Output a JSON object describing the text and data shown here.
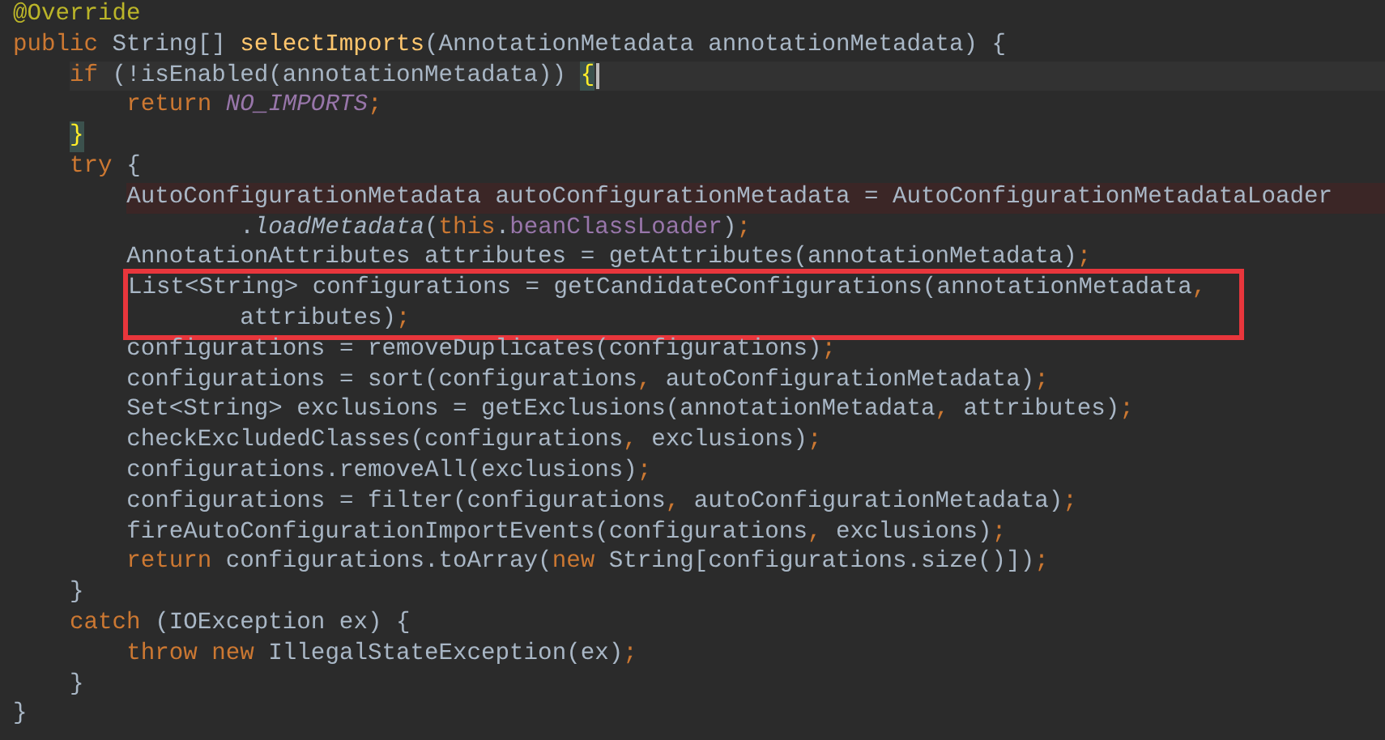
{
  "editor": {
    "lines": [
      {
        "kind": "line",
        "current": false,
        "marked": false,
        "boxed": false,
        "tokens": [
          {
            "text": "@Override",
            "kind": "annotation"
          }
        ]
      },
      {
        "kind": "line",
        "current": false,
        "marked": false,
        "boxed": false,
        "tokens": [
          {
            "text": "public",
            "kind": "keyword"
          },
          {
            "text": " String[] ",
            "kind": "plain"
          },
          {
            "text": "selectImports",
            "kind": "decl"
          },
          {
            "text": "(AnnotationMetadata annotationMetadata) {",
            "kind": "plain"
          }
        ],
        "children": [
          {
            "kind": "line",
            "current": true,
            "marked": false,
            "boxed": false,
            "tokens": [
              {
                "text": "if",
                "kind": "keyword"
              },
              {
                "text": " (!isEnabled(annotationMetadata)) ",
                "kind": "plain"
              },
              {
                "text": "{",
                "kind": "match"
              }
            ],
            "children": [
              {
                "kind": "line",
                "current": false,
                "marked": false,
                "boxed": false,
                "tokens": [
                  {
                    "text": "return ",
                    "kind": "keyword"
                  },
                  {
                    "text": "NO_IMPORTS",
                    "kind": "constant"
                  },
                  {
                    "text": ";",
                    "kind": "punct"
                  }
                ]
              }
            ]
          },
          {
            "kind": "line",
            "current": false,
            "marked": false,
            "boxed": false,
            "tokens": [
              {
                "text": "}",
                "kind": "match"
              }
            ]
          },
          {
            "kind": "line",
            "current": false,
            "marked": false,
            "boxed": false,
            "tokens": [
              {
                "text": "try",
                "kind": "keyword"
              },
              {
                "text": " {",
                "kind": "plain"
              }
            ],
            "children": [
              {
                "kind": "line",
                "current": false,
                "marked": true,
                "boxed": false,
                "tokens": [
                  {
                    "text": "AutoConfigurationMetadata autoConfigurationMetadata = AutoConfigurationMetadataLoader",
                    "kind": "plain"
                  }
                ],
                "children": [
                  {
                    "kind": "continuation",
                    "current": false,
                    "marked": false,
                    "boxed": false,
                    "tokens": [
                      {
                        "text": ".",
                        "kind": "plain"
                      },
                      {
                        "text": "loadMetadata",
                        "kind": "static"
                      },
                      {
                        "text": "(",
                        "kind": "plain"
                      },
                      {
                        "text": "this",
                        "kind": "keyword"
                      },
                      {
                        "text": ".",
                        "kind": "plain"
                      },
                      {
                        "text": "beanClassLoader",
                        "kind": "field"
                      },
                      {
                        "text": ")",
                        "kind": "plain"
                      },
                      {
                        "text": ";",
                        "kind": "punct"
                      }
                    ]
                  }
                ]
              },
              {
                "kind": "line",
                "current": false,
                "marked": false,
                "boxed": false,
                "tokens": [
                  {
                    "text": "AnnotationAttributes attributes = getAttributes(annotationMetadata)",
                    "kind": "plain"
                  },
                  {
                    "text": ";",
                    "kind": "punct"
                  }
                ]
              },
              {
                "kind": "line",
                "current": false,
                "marked": false,
                "boxed": true,
                "tokens": [
                  {
                    "text": "List<String> configurations = getCandidateConfigurations(annotationMetadata",
                    "kind": "plain"
                  },
                  {
                    "text": ",",
                    "kind": "punct"
                  }
                ],
                "children": [
                  {
                    "kind": "continuation",
                    "current": false,
                    "marked": false,
                    "boxed": false,
                    "tokens": [
                      {
                        "text": "attributes)",
                        "kind": "plain"
                      },
                      {
                        "text": ";",
                        "kind": "punct"
                      }
                    ]
                  }
                ]
              },
              {
                "kind": "line",
                "current": false,
                "marked": false,
                "boxed": false,
                "tokens": [
                  {
                    "text": "configurations = removeDuplicates(configurations)",
                    "kind": "plain"
                  },
                  {
                    "text": ";",
                    "kind": "punct"
                  }
                ]
              },
              {
                "kind": "line",
                "current": false,
                "marked": false,
                "boxed": false,
                "tokens": [
                  {
                    "text": "configurations = sort(configurations",
                    "kind": "plain"
                  },
                  {
                    "text": ",",
                    "kind": "punct"
                  },
                  {
                    "text": " autoConfigurationMetadata)",
                    "kind": "plain"
                  },
                  {
                    "text": ";",
                    "kind": "punct"
                  }
                ]
              },
              {
                "kind": "line",
                "current": false,
                "marked": false,
                "boxed": false,
                "tokens": [
                  {
                    "text": "Set<String> exclusions = getExclusions(annotationMetadata",
                    "kind": "plain"
                  },
                  {
                    "text": ",",
                    "kind": "punct"
                  },
                  {
                    "text": " attributes)",
                    "kind": "plain"
                  },
                  {
                    "text": ";",
                    "kind": "punct"
                  }
                ]
              },
              {
                "kind": "line",
                "current": false,
                "marked": false,
                "boxed": false,
                "tokens": [
                  {
                    "text": "checkExcludedClasses(configurations",
                    "kind": "plain"
                  },
                  {
                    "text": ",",
                    "kind": "punct"
                  },
                  {
                    "text": " exclusions)",
                    "kind": "plain"
                  },
                  {
                    "text": ";",
                    "kind": "punct"
                  }
                ]
              },
              {
                "kind": "line",
                "current": false,
                "marked": false,
                "boxed": false,
                "tokens": [
                  {
                    "text": "configurations.removeAll(exclusions)",
                    "kind": "plain"
                  },
                  {
                    "text": ";",
                    "kind": "punct"
                  }
                ]
              },
              {
                "kind": "line",
                "current": false,
                "marked": false,
                "boxed": false,
                "tokens": [
                  {
                    "text": "configurations = filter(configurations",
                    "kind": "plain"
                  },
                  {
                    "text": ",",
                    "kind": "punct"
                  },
                  {
                    "text": " autoConfigurationMetadata)",
                    "kind": "plain"
                  },
                  {
                    "text": ";",
                    "kind": "punct"
                  }
                ]
              },
              {
                "kind": "line",
                "current": false,
                "marked": false,
                "boxed": false,
                "tokens": [
                  {
                    "text": "fireAutoConfigurationImportEvents(configurations",
                    "kind": "plain"
                  },
                  {
                    "text": ",",
                    "kind": "punct"
                  },
                  {
                    "text": " exclusions)",
                    "kind": "plain"
                  },
                  {
                    "text": ";",
                    "kind": "punct"
                  }
                ]
              },
              {
                "kind": "line",
                "current": false,
                "marked": false,
                "boxed": false,
                "tokens": [
                  {
                    "text": "return",
                    "kind": "keyword"
                  },
                  {
                    "text": " configurations.toArray(",
                    "kind": "plain"
                  },
                  {
                    "text": "new",
                    "kind": "keyword"
                  },
                  {
                    "text": " String[configurations.size()])",
                    "kind": "plain"
                  },
                  {
                    "text": ";",
                    "kind": "punct"
                  }
                ]
              }
            ]
          },
          {
            "kind": "line",
            "current": false,
            "marked": false,
            "boxed": false,
            "tokens": [
              {
                "text": "}",
                "kind": "plain"
              }
            ]
          },
          {
            "kind": "line",
            "current": false,
            "marked": false,
            "boxed": false,
            "tokens": [
              {
                "text": "catch",
                "kind": "keyword"
              },
              {
                "text": " (IOException ex) {",
                "kind": "plain"
              }
            ],
            "children": [
              {
                "kind": "line",
                "current": false,
                "marked": false,
                "boxed": false,
                "tokens": [
                  {
                    "text": "throw new",
                    "kind": "keyword"
                  },
                  {
                    "text": " IllegalStateException(ex)",
                    "kind": "plain"
                  },
                  {
                    "text": ";",
                    "kind": "punct"
                  }
                ]
              }
            ]
          },
          {
            "kind": "line",
            "current": false,
            "marked": false,
            "boxed": false,
            "tokens": [
              {
                "text": "}",
                "kind": "plain"
              }
            ]
          }
        ]
      },
      {
        "kind": "line",
        "current": false,
        "marked": false,
        "boxed": false,
        "tokens": [
          {
            "text": "}",
            "kind": "plain"
          }
        ]
      }
    ]
  }
}
